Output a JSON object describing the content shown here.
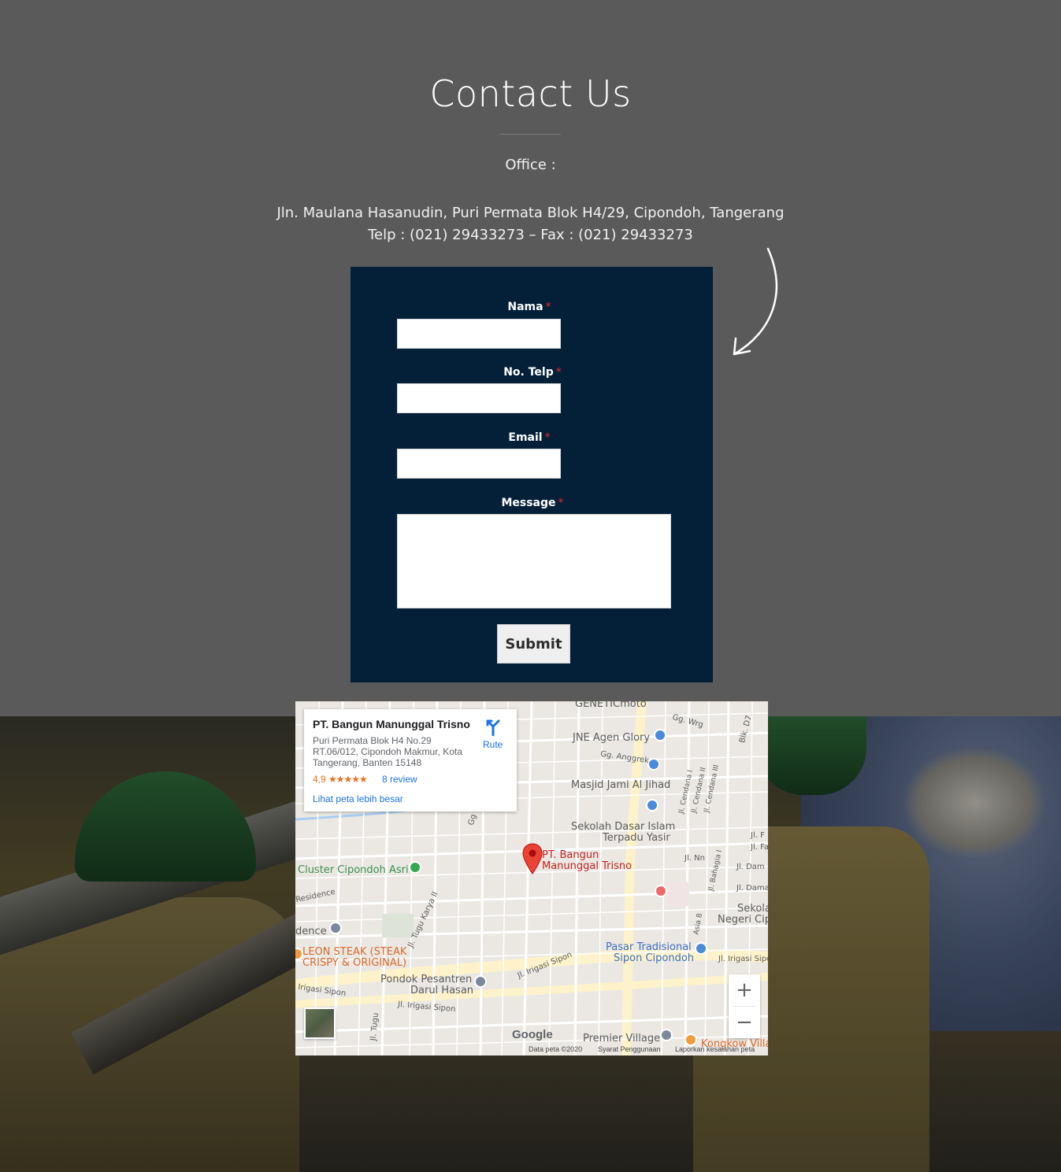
{
  "page": {
    "title": "Contact Us",
    "office_label": "Office :",
    "address_line1": "Jln. Maulana Hasanudin, Puri Permata Blok H4/29, Cipondoh, Tangerang",
    "address_line2": "Telp : (021) 29433273 – Fax : (021) 29433273"
  },
  "form": {
    "fields": [
      {
        "label": "Nama",
        "required_mark": "*",
        "value": ""
      },
      {
        "label": "No. Telp",
        "required_mark": "*",
        "value": ""
      },
      {
        "label": "Email",
        "required_mark": "*",
        "value": ""
      },
      {
        "label": "Message",
        "required_mark": "*",
        "value": ""
      }
    ],
    "submit_label": "Submit"
  },
  "map": {
    "card": {
      "name": "PT. Bangun Manunggal Trisno",
      "address": "Puri Permata Blok H4 No.29 RT.06/012, Cipondoh Makmur, Kota Tangerang, Banten 15148",
      "rating": "4,9",
      "stars": "★★★★★",
      "reviews": "8 review",
      "bigger_map": "Lihat peta lebih besar",
      "route_label": "Rute"
    },
    "pois": {
      "genetic": "GENETICmoto",
      "jne": "JNE Agen Glory",
      "masjid": "Masjid Jami Al Jihad",
      "sekolah": "Sekolah Dasar Islam",
      "sekolah2": "Terpadu Yasir",
      "marker1": "PT. Bangun",
      "marker2": "Manunggal Trisno",
      "cluster": "Cluster Cipondoh Asri",
      "residence": "Residence",
      "dence": "dence",
      "leon1": "LEON STEAK (STEAK",
      "leon2": "CRISPY & ORIGINAL)",
      "pondok1": "Pondok Pesantren",
      "pondok2": "Darul Hasan",
      "pasar1": "Pasar Tradisional",
      "pasar2": "Sipon Cipondoh",
      "premier": "Premier Village",
      "kongkow": "Kongkow Villa",
      "sekolah_negeri1": "Sekola",
      "sekolah_negeri2": "Negeri Cip",
      "jl_irigasi": "Jl. Irigasi Sipon",
      "jl_irigasi_right": "Jl. Irigasi Sipon",
      "irigasi_left": "Irigasi Sipon",
      "jl_irigasi_mid": "Jl. Irigasi Sipon",
      "gg_wrg": "Gg. Wrg",
      "gg_anggrek": "Gg. Anggrek",
      "blk": "Blk. D7",
      "jl_tugu": "Jl. Tugu",
      "jl_tugu_raya": "Jl. Tugu Karya II",
      "cendana1": "Jl. Cendana I",
      "cendana2": "Jl. Cendana II",
      "cendana3": "Jl. Cendana III",
      "bahagia": "Jl. Bahagia I",
      "asia": "Asia 8",
      "jl_nn": "Jl. Nn",
      "jl_dam": "Jl. Dam",
      "jl_damai": "Jl. Damai",
      "jl_f": "Jl. F",
      "jl_fa": "Jl. Fa",
      "gg": "Gg"
    },
    "google": "Google",
    "attribution": {
      "data": "Data peta ©2020",
      "terms": "Syarat Penggunaan",
      "report": "Laporkan kesalahan peta"
    }
  }
}
